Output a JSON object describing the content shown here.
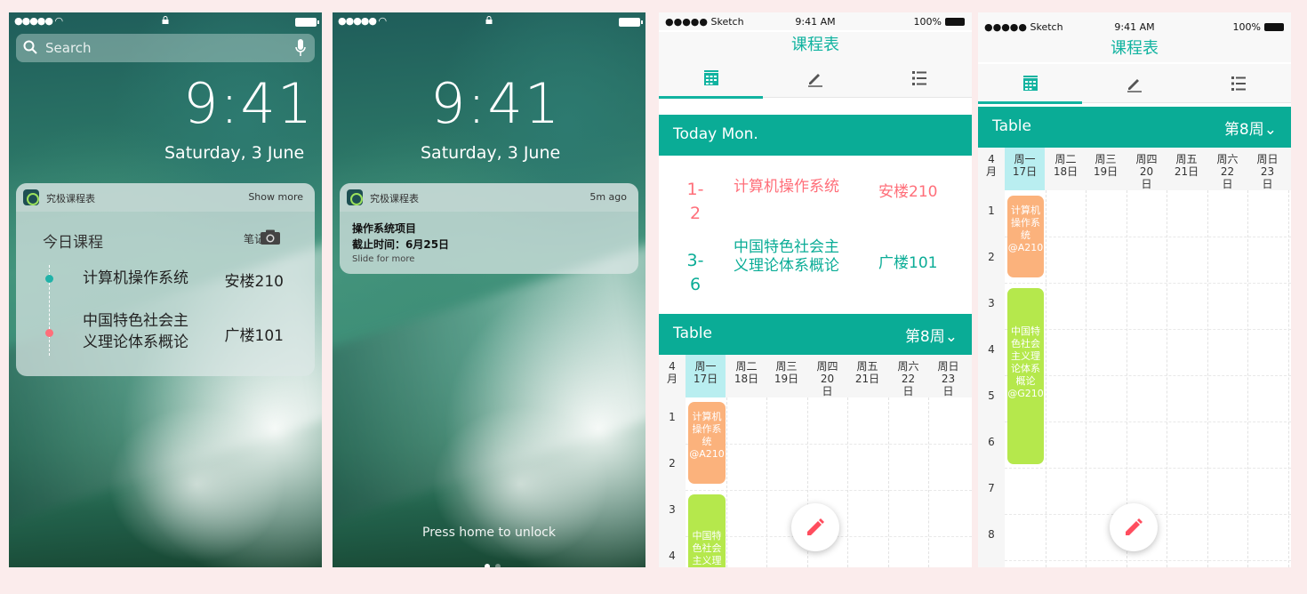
{
  "lockscreen1": {
    "search_placeholder": "Search",
    "time": "9:41",
    "date": "Saturday, 3 June",
    "widget": {
      "app_name": "究极课程表",
      "show_more": "Show more",
      "title": "今日课程",
      "note_label": "笔记",
      "courses": [
        {
          "name": "计算机操作系统",
          "room": "安楼210",
          "color": "#20b2a8"
        },
        {
          "name_line1": "中国特色社会主",
          "name_line2": "义理论体系概论",
          "room": "广楼101",
          "color": "#ff6f7a"
        }
      ]
    }
  },
  "lockscreen2": {
    "time": "9:41",
    "date": "Saturday, 3 June",
    "notification": {
      "app_name": "究极课程表",
      "ago": "5m ago",
      "line1": "操作系统项目",
      "line2": "截止时间：6月25日",
      "hint": "Slide for more"
    },
    "unlock_text": "Press home to unlock"
  },
  "app": {
    "carrier": "●●●●● Sketch",
    "time": "9:41 AM",
    "battery": "100%",
    "title": "课程表",
    "accent": "#0aac96",
    "today_label": "Today Mon.",
    "today_courses": [
      {
        "period_a": "1-",
        "period_b": "2",
        "name": "计算机操作系统",
        "room": "安楼210",
        "color": "#ff6f7a"
      },
      {
        "period_a": "3-",
        "period_b": "6",
        "name_line1": "中国特色社会主",
        "name_line2": "义理论体系概论",
        "room": "广楼101",
        "color": "#0aac96"
      }
    ],
    "table_label": "Table",
    "week_label": "第8周⌄",
    "month": [
      "4",
      "月"
    ],
    "days": [
      {
        "w": "周一",
        "d": "17日"
      },
      {
        "w": "周二",
        "d": "18日"
      },
      {
        "w": "周三",
        "d": "19日"
      },
      {
        "w": "周四",
        "d1": "20",
        "d2": "日"
      },
      {
        "w": "周五",
        "d": "21日"
      },
      {
        "w": "周六",
        "d1": "22",
        "d2": "日"
      },
      {
        "w": "周日",
        "d1": "23",
        "d2": "日"
      }
    ],
    "periods": [
      "1",
      "2",
      "3",
      "4",
      "5",
      "6",
      "7",
      "8"
    ],
    "blocks": [
      {
        "lines": [
          "计算机",
          "操作系",
          "统",
          "@A210"
        ],
        "color": "#fbb27c"
      },
      {
        "lines": [
          "中国特",
          "色社会",
          "主义理",
          "论体系",
          "概论",
          "@G210"
        ],
        "color": "#b5e84c"
      }
    ]
  }
}
